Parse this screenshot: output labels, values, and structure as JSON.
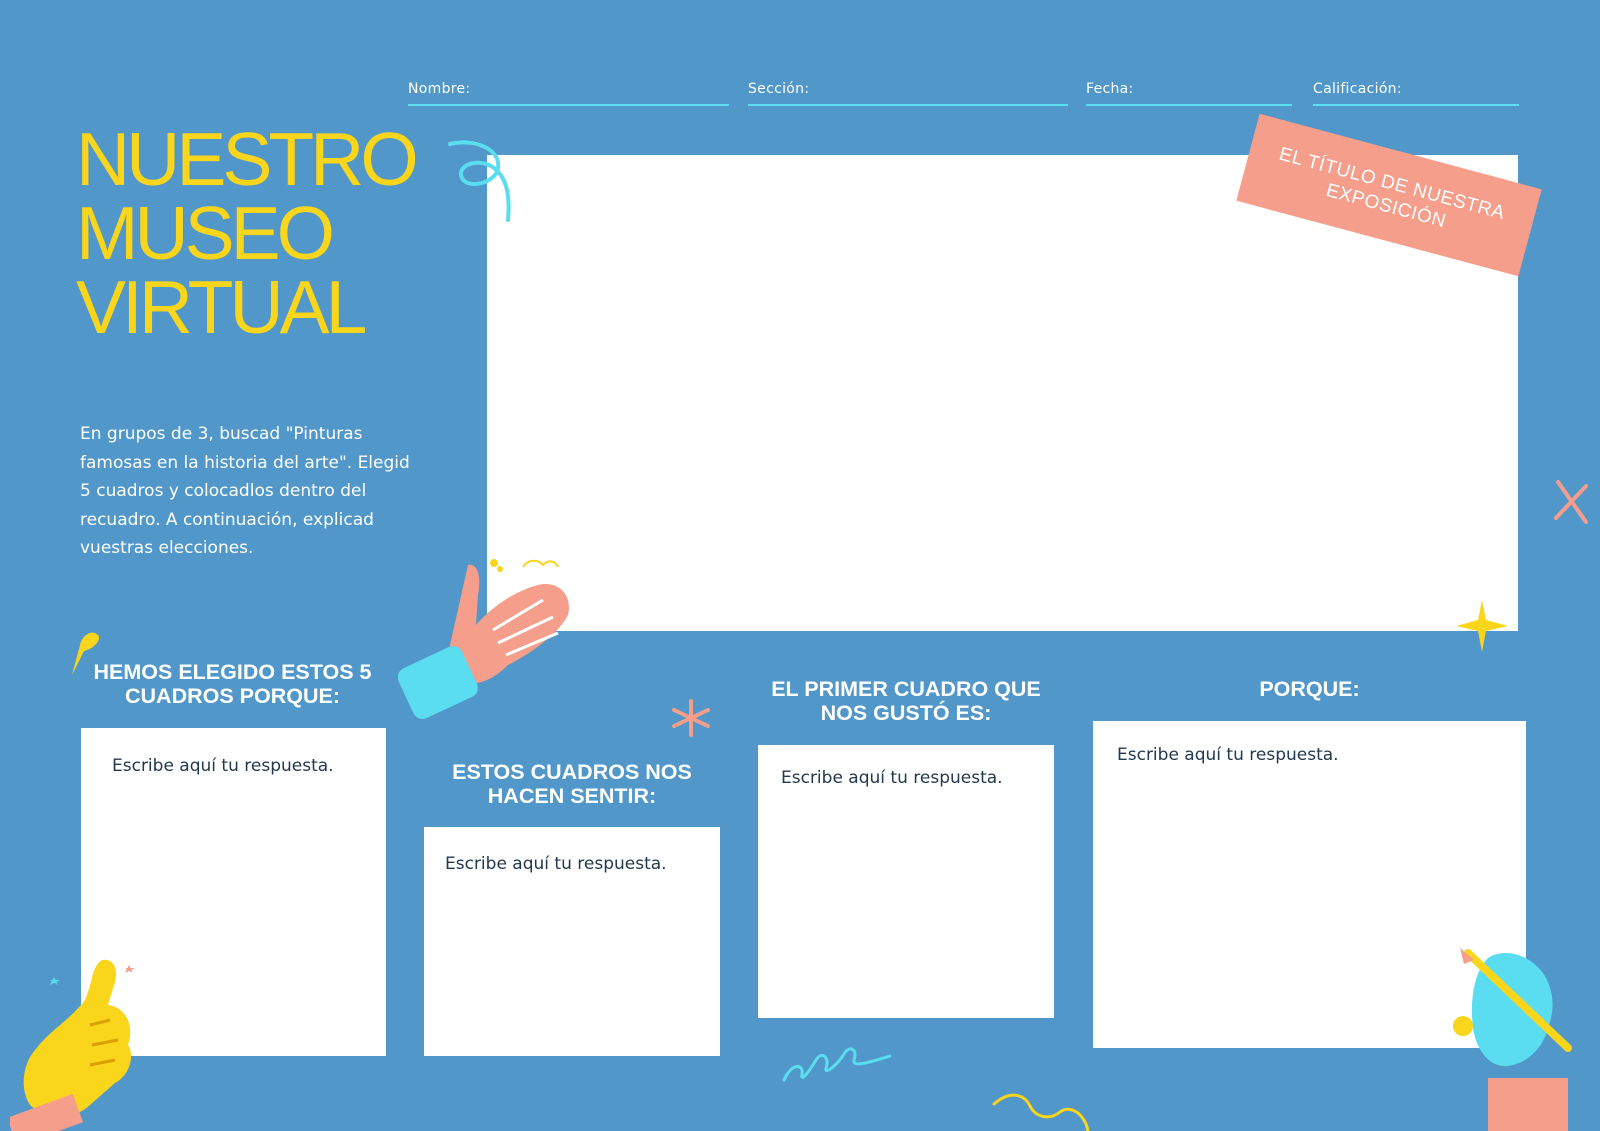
{
  "header_fields": {
    "nombre": "Nombre:",
    "seccion": "Sección:",
    "fecha": "Fecha:",
    "calificacion": "Calificación:"
  },
  "title": {
    "line1": "NUESTRO",
    "line2": "MUSEO",
    "line3": "VIRTUAL"
  },
  "instructions": "En grupos de 3, buscad \"Pinturas famosas en la historia del arte\". Elegid 5 cuadros y colocadlos dentro del recuadro. A continuación, explicad vuestras elecciones.",
  "exhibition_banner": "EL TÍTULO DE NUESTRA EXPOSICIÓN",
  "sections": [
    {
      "heading": "HEMOS ELEGIDO ESTOS 5 CUADROS PORQUE:",
      "answer": "Escribe aquí tu respuesta."
    },
    {
      "heading": "ESTOS CUADROS NOS HACEN SENTIR:",
      "answer": "Escribe aquí tu respuesta."
    },
    {
      "heading": "EL PRIMER CUADRO QUE NOS GUSTÓ ES:",
      "answer": "Escribe aquí tu respuesta."
    },
    {
      "heading": "PORQUE:",
      "answer": "Escribe aquí tu respuesta."
    }
  ],
  "colors": {
    "background": "#5197C9",
    "title": "#F9D51B",
    "banner": "#F59E8B",
    "field_line": "#5ADDF0",
    "answer_text": "#22384F"
  },
  "icons": [
    "pointing-hand-icon",
    "thumbs-up-hand-icon",
    "writing-hand-icon",
    "squiggle-icon",
    "sparkle-icon",
    "asterisk-icon",
    "cross-icon"
  ]
}
